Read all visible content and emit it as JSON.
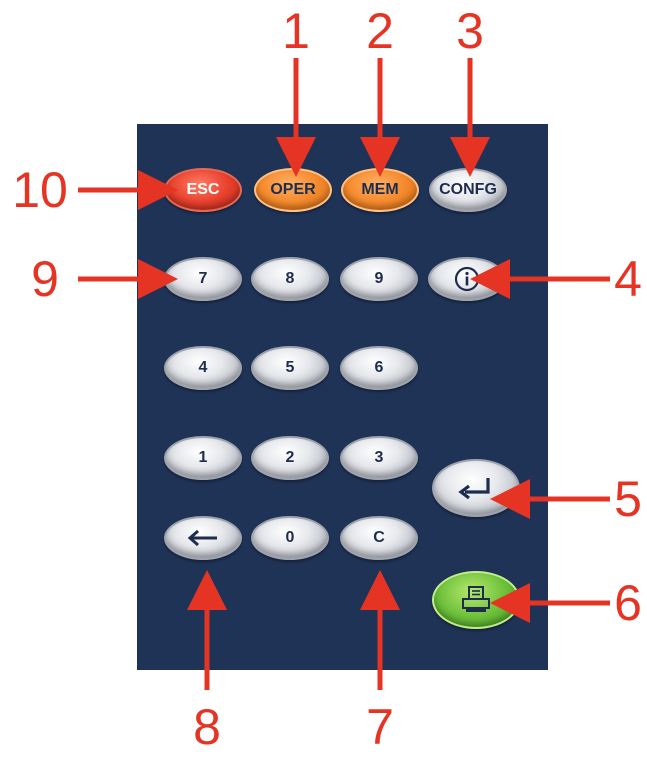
{
  "keys": {
    "esc": "ESC",
    "oper": "OPER",
    "mem": "MEM",
    "config": "CONFG",
    "info_icon": "info-icon",
    "k7": "7",
    "k8": "8",
    "k9": "9",
    "k4": "4",
    "k5": "5",
    "k6": "6",
    "k1": "1",
    "k2": "2",
    "k3": "3",
    "back_icon": "left-arrow-icon",
    "k0": "0",
    "clear": "C",
    "enter_icon": "enter-icon",
    "print_icon": "printer-icon"
  },
  "callouts": {
    "c1": "1",
    "c2": "2",
    "c3": "3",
    "c4": "4",
    "c5": "5",
    "c6": "6",
    "c7": "7",
    "c8": "8",
    "c9": "9",
    "c10": "10"
  },
  "colors": {
    "panel": "#1f3357",
    "callout": "#e53424",
    "esc_key": "#e8412e",
    "oper_key": "#f58a2c",
    "print_key": "#6fc13b",
    "key_text": "#1e2d4e"
  }
}
